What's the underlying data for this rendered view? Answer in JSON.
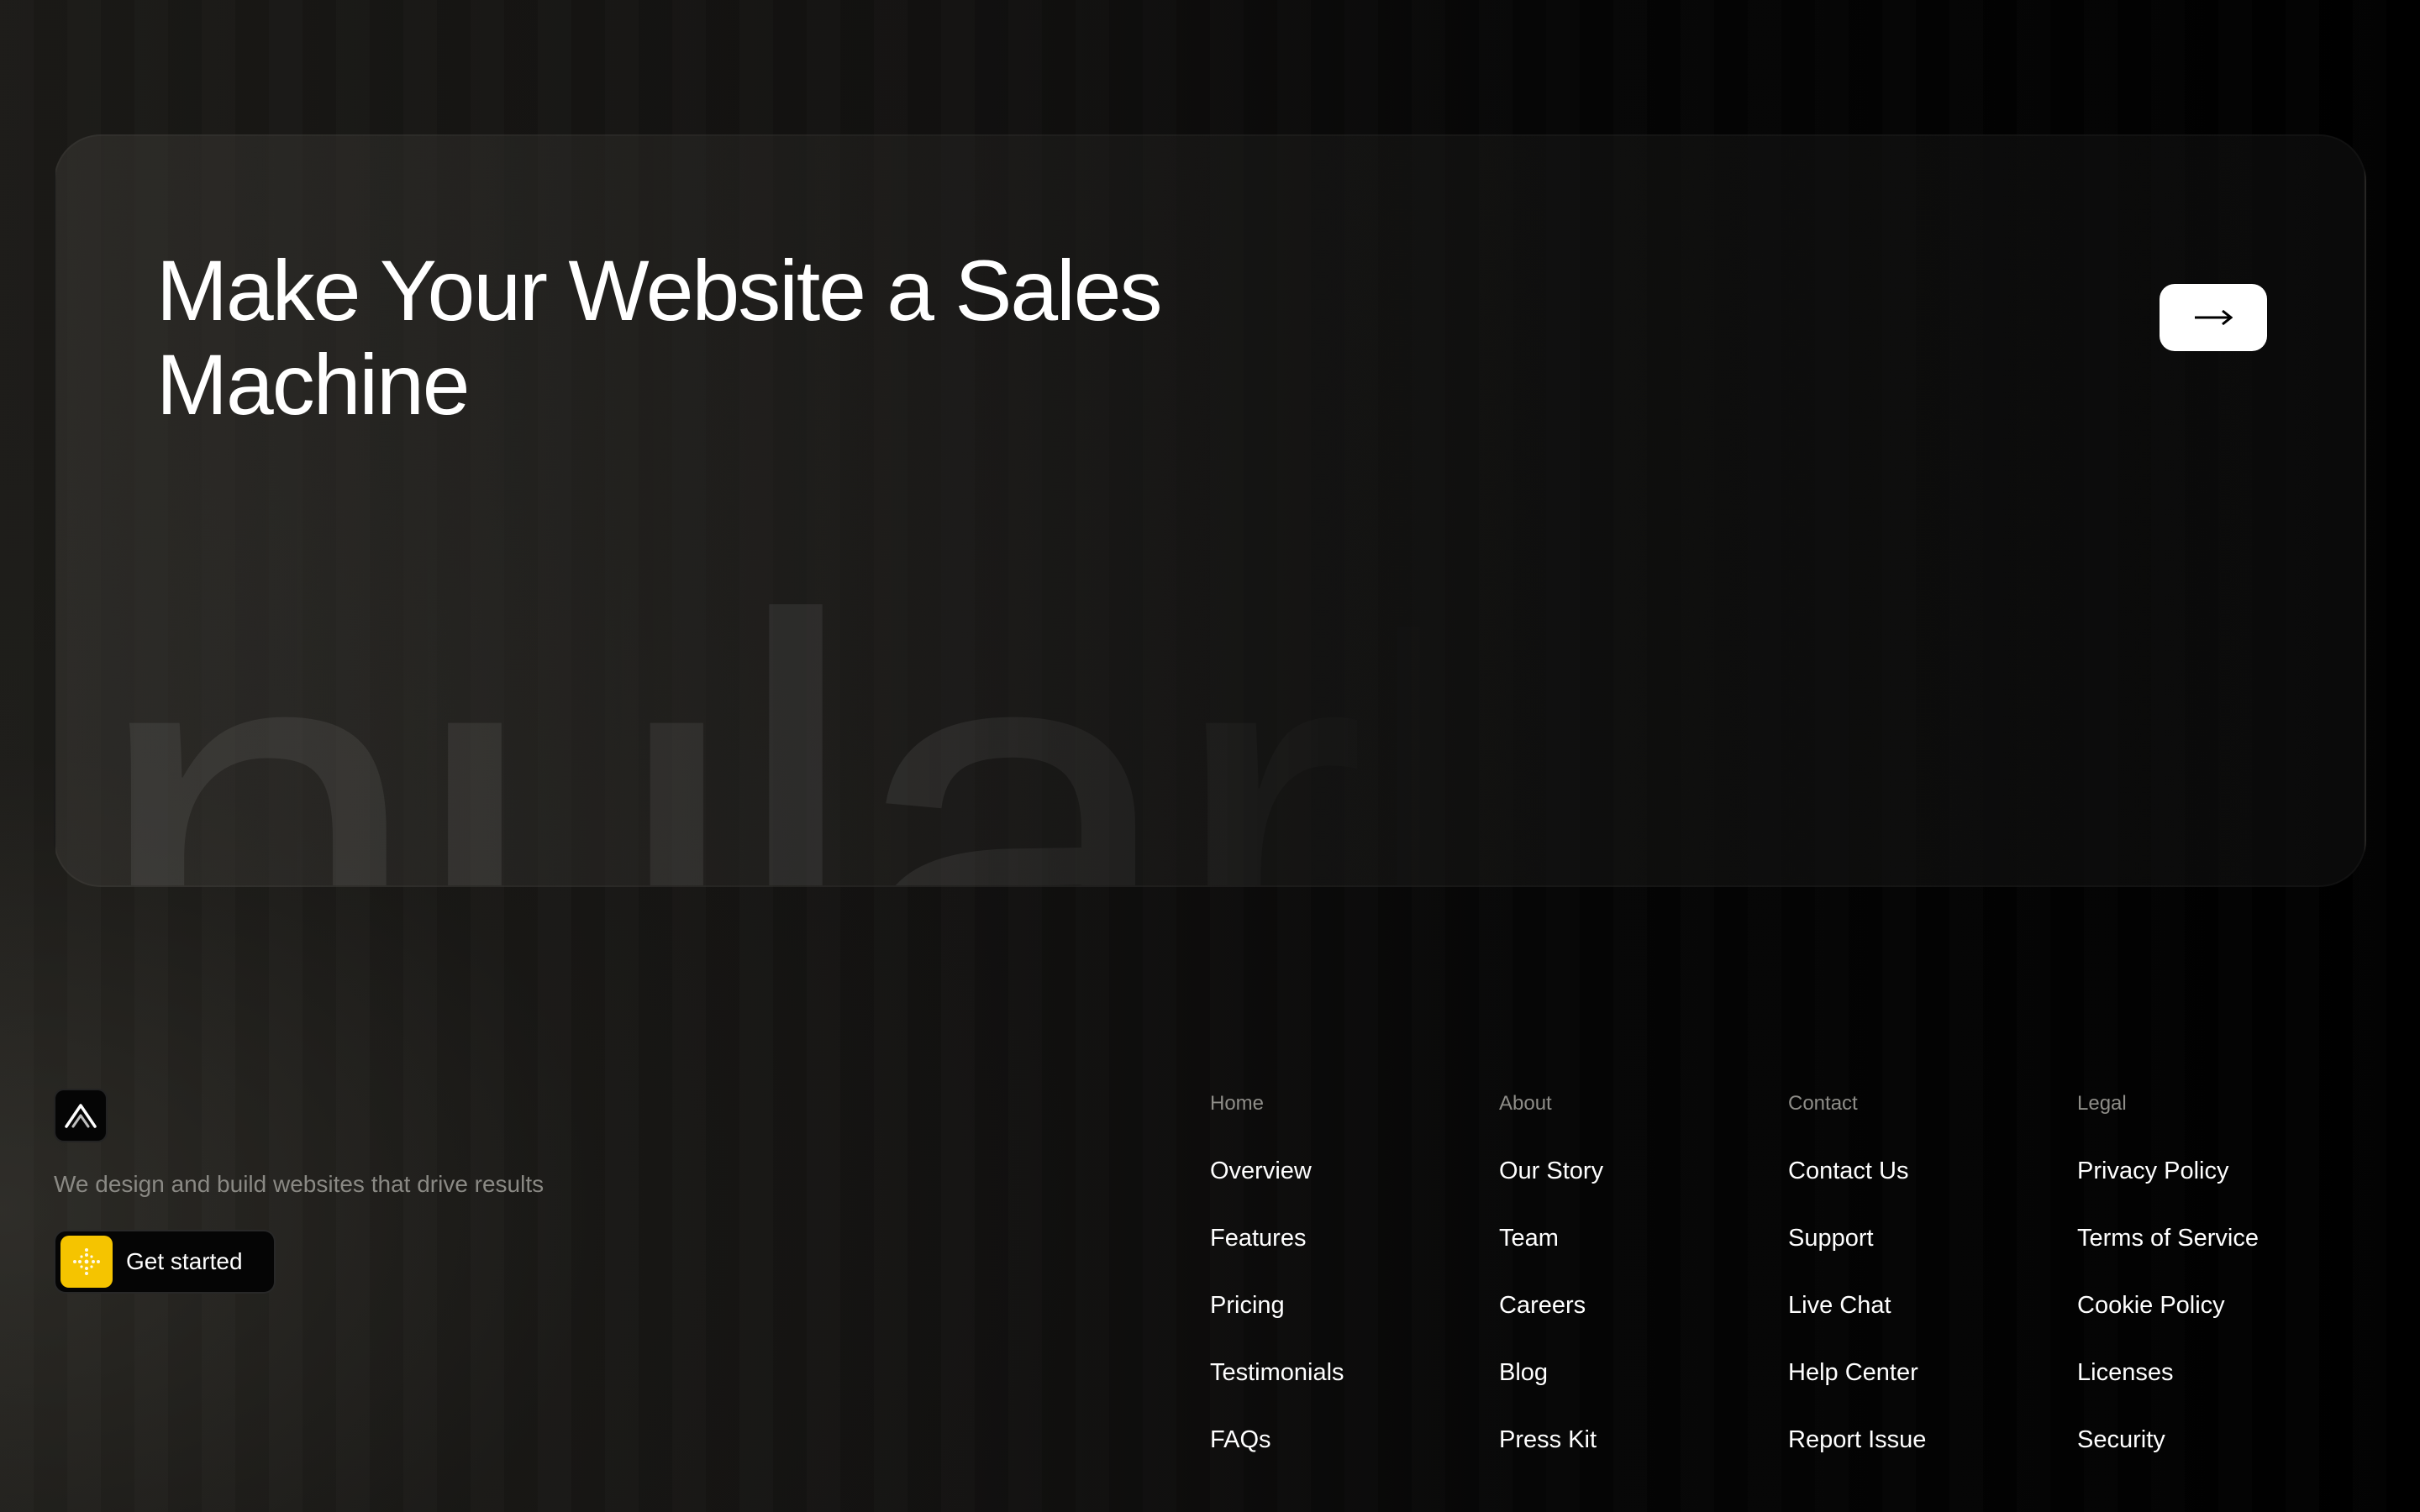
{
  "hero": {
    "title": "Make Your Website a Sales Machine",
    "watermark": "nularUI"
  },
  "brand": {
    "tagline": "We design and build websites that drive results",
    "cta_label": "Get started"
  },
  "footer": {
    "columns": [
      {
        "heading": "Home",
        "links": [
          "Overview",
          "Features",
          "Pricing",
          "Testimonials",
          "FAQs"
        ]
      },
      {
        "heading": "About",
        "links": [
          "Our Story",
          "Team",
          "Careers",
          "Blog",
          "Press Kit"
        ]
      },
      {
        "heading": "Contact",
        "links": [
          "Contact Us",
          "Support",
          "Live Chat",
          "Help Center",
          "Report Issue"
        ]
      },
      {
        "heading": "Legal",
        "links": [
          "Privacy Policy",
          "Terms of Service",
          "Cookie Policy",
          "Licenses",
          "Security"
        ]
      }
    ]
  },
  "colors": {
    "accent": "#f5c400",
    "text_primary": "#ffffff",
    "text_muted": "#8a8984",
    "background": "#0a0a0a"
  },
  "icons": {
    "hero_action": "arrow-right-icon",
    "logo": "logo-mountain-icon",
    "cta": "dotted-cross-icon"
  }
}
